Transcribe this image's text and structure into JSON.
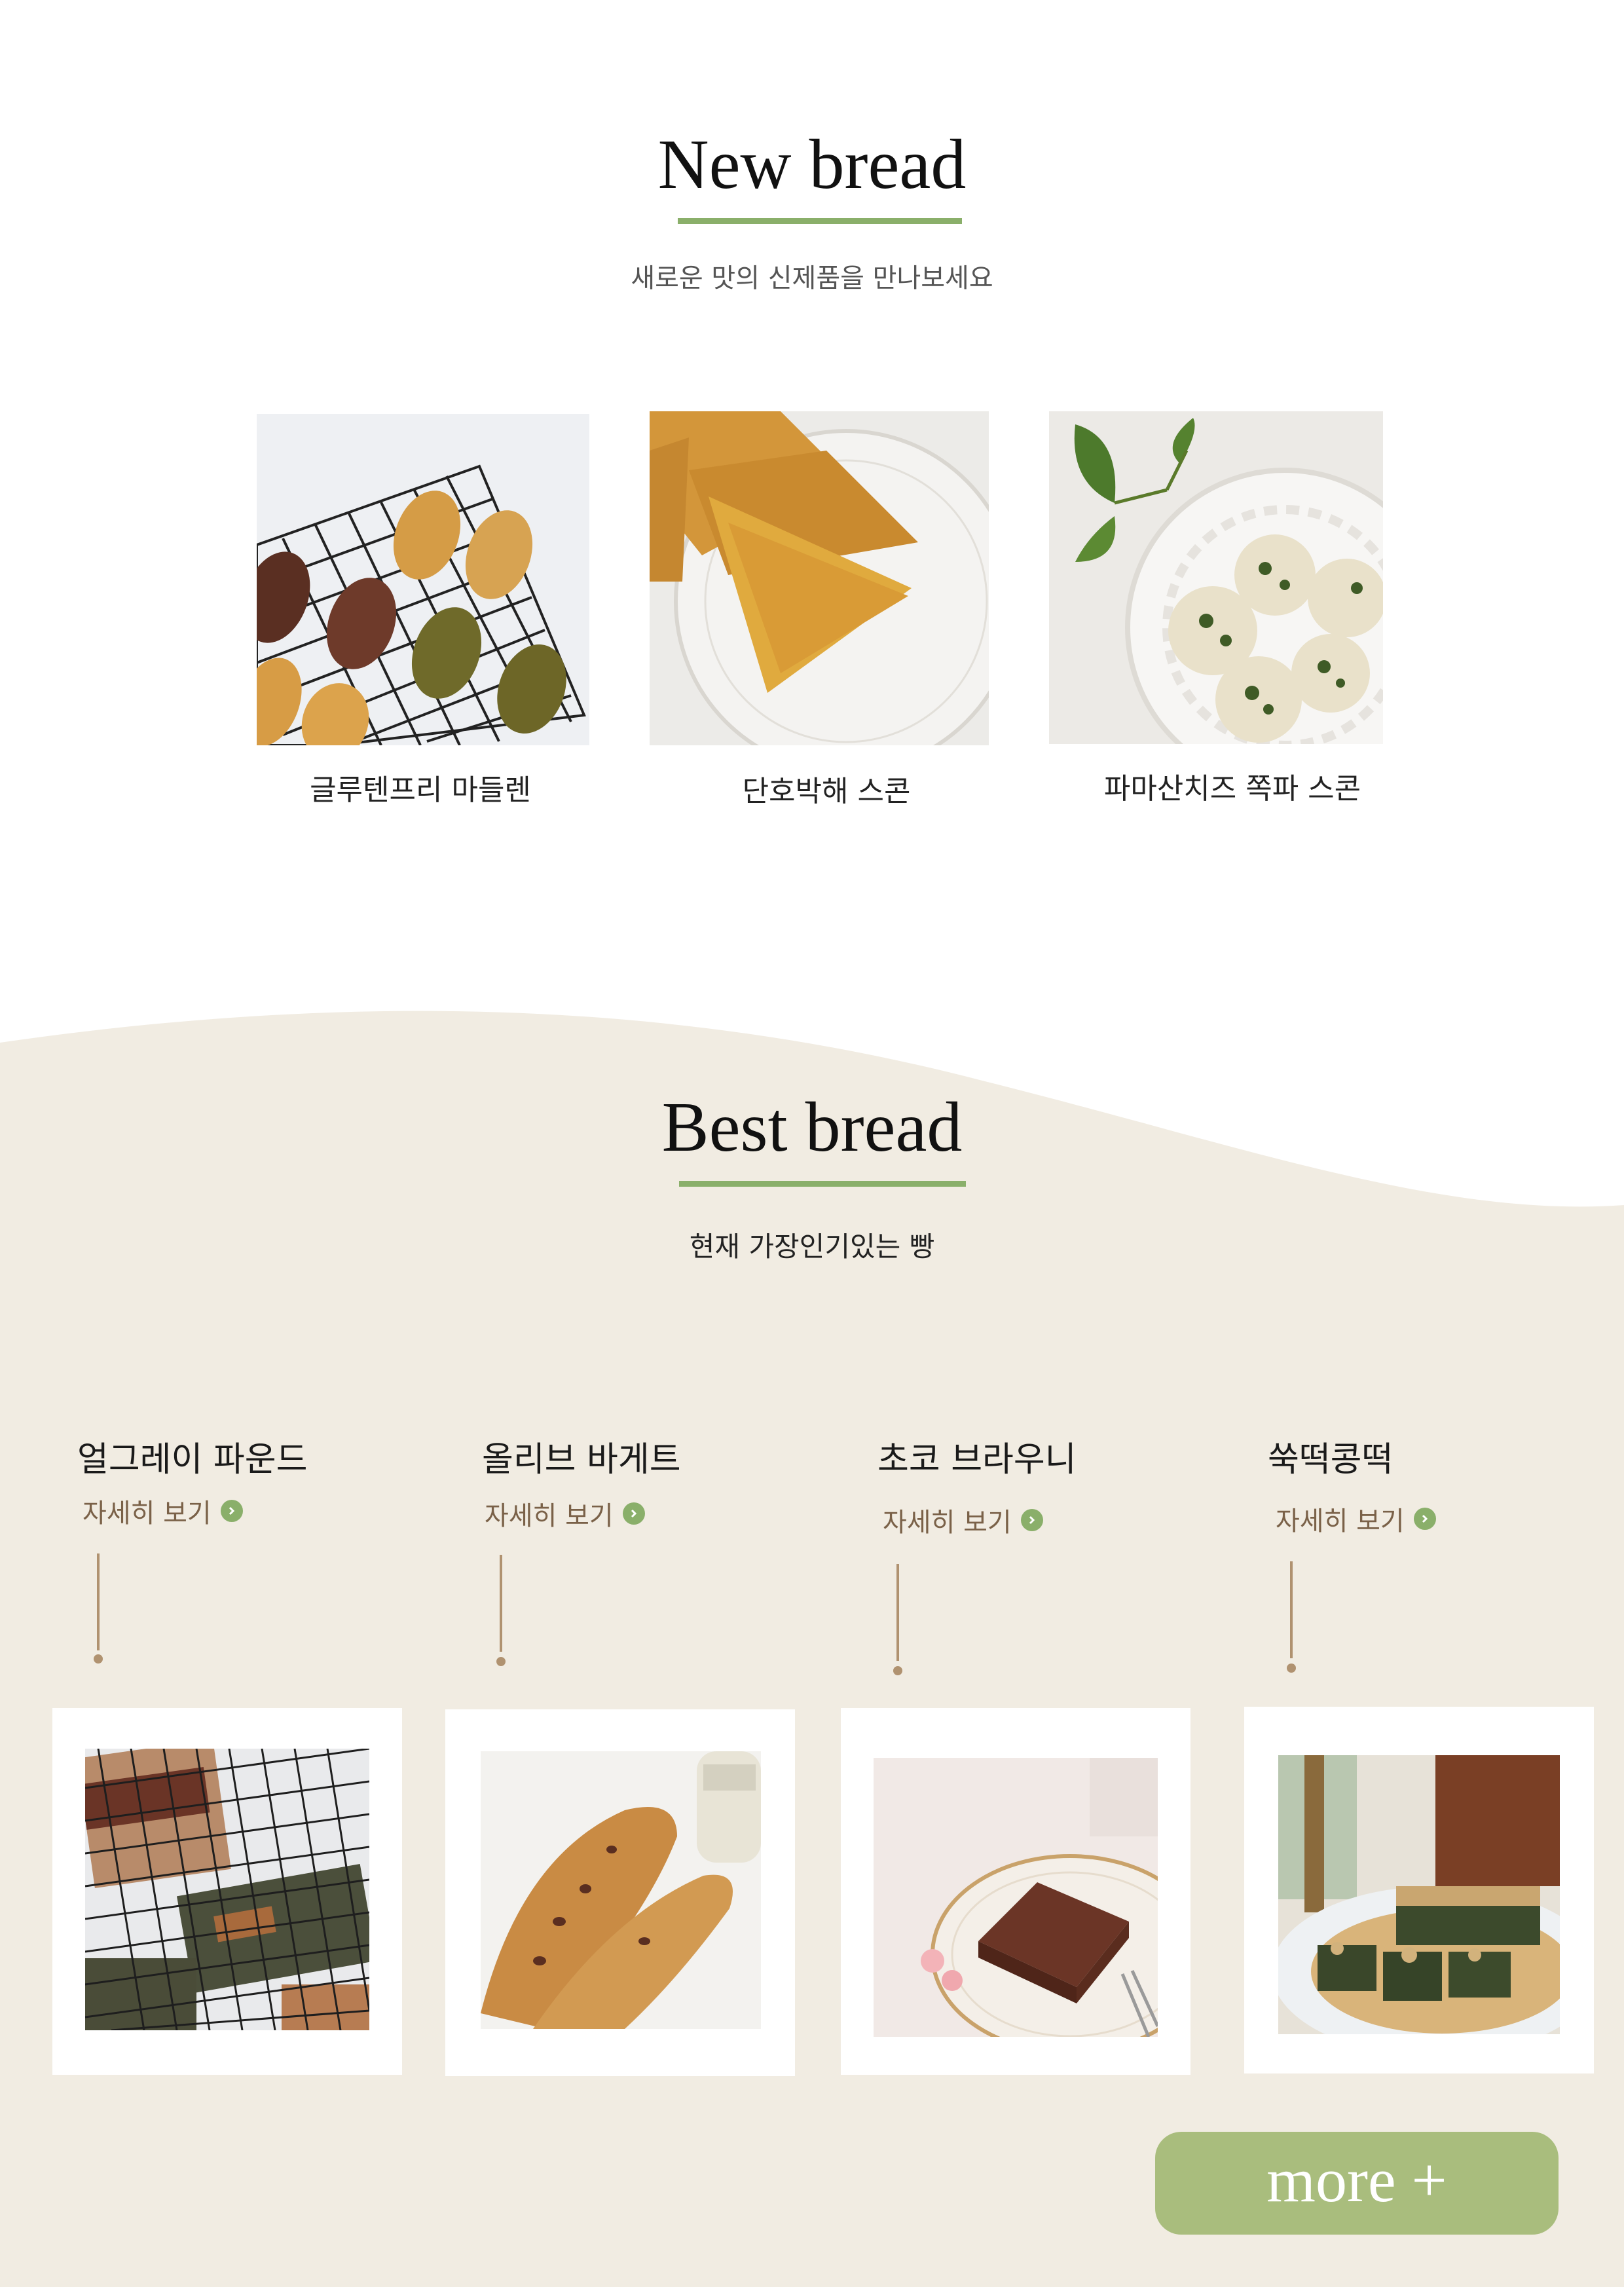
{
  "colors": {
    "accent_green": "#8aaf6a",
    "cream_background": "#f1ece2",
    "link_brown": "#7a6148",
    "more_button": "#a9bd7d"
  },
  "new_bread": {
    "title": "New bread",
    "subtitle": "새로운 맛의 신제품을 만나보세요",
    "items": [
      {
        "name": "글루텐프리 마들렌",
        "photo": "madeleine-photo"
      },
      {
        "name": "단호박해 스콘",
        "photo": "pumpkin-scone-photo"
      },
      {
        "name": "파마산치즈 쪽파 스콘",
        "photo": "parmesan-scallion-scone-photo"
      }
    ]
  },
  "best_bread": {
    "title": "Best bread",
    "subtitle": "현재 가장인기있는 빵",
    "items": [
      {
        "name": "얼그레이 파운드",
        "link_label": "자세히 보기",
        "photo": "earl-grey-pound-photo"
      },
      {
        "name": "올리브 바게트",
        "link_label": "자세히 보기",
        "photo": "olive-baguette-photo"
      },
      {
        "name": "초코 브라우니",
        "link_label": "자세히 보기",
        "photo": "choco-brownie-photo"
      },
      {
        "name": "쑥떡콩떡",
        "link_label": "자세히 보기",
        "photo": "mugwort-bean-cake-photo"
      }
    ]
  },
  "more_button_label": "more +"
}
